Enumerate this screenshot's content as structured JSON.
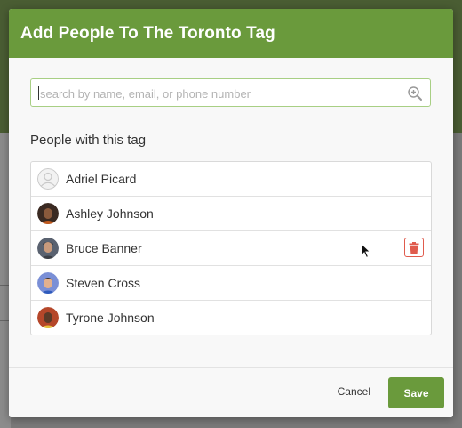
{
  "modal": {
    "title": "Add People To The Toronto Tag",
    "search": {
      "placeholder": "search by name, email, or phone number",
      "value": ""
    },
    "section_title": "People with this tag",
    "people": [
      {
        "name": "Adriel Picard",
        "avatar": "placeholder-avatar"
      },
      {
        "name": "Ashley Johnson",
        "avatar": "photo-avatar"
      },
      {
        "name": "Bruce Banner",
        "avatar": "photo-avatar",
        "hovered": true
      },
      {
        "name": "Steven Cross",
        "avatar": "photo-avatar"
      },
      {
        "name": "Tyrone Johnson",
        "avatar": "photo-avatar"
      }
    ],
    "footer": {
      "cancel_label": "Cancel",
      "save_label": "Save"
    }
  },
  "icons": {
    "search": "search-plus-icon",
    "delete": "trash-icon"
  },
  "colors": {
    "header": "#6a9a3c",
    "save_button": "#6a9a3c",
    "delete": "#e05b4d",
    "search_border": "#a8cf84"
  }
}
